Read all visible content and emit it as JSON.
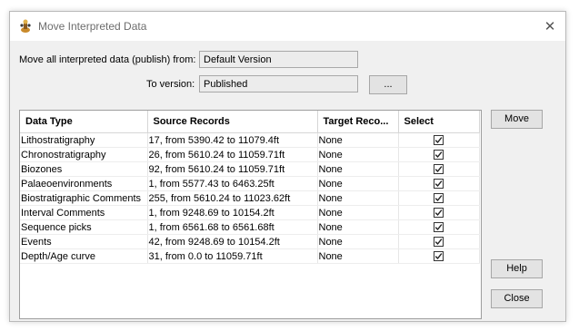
{
  "window": {
    "title": "Move Interpreted Data",
    "icon": "app-icon",
    "close_icon": "close-icon"
  },
  "form": {
    "from_label": "Move all interpreted data (publish) from:",
    "from_value": "Default Version",
    "to_label": "To version:",
    "to_value": "Published",
    "browse_label": "..."
  },
  "table": {
    "headers": [
      "Data Type",
      "Source Records",
      "Target Reco...",
      "Select"
    ],
    "rows": [
      {
        "type": "Lithostratigraphy",
        "source": "17, from 5390.42 to 11079.4ft",
        "target": "None",
        "selected": true
      },
      {
        "type": "Chronostratigraphy",
        "source": "26, from 5610.24 to 11059.71ft",
        "target": "None",
        "selected": true
      },
      {
        "type": "Biozones",
        "source": "92, from 5610.24 to 11059.71ft",
        "target": "None",
        "selected": true
      },
      {
        "type": "Palaeoenvironments",
        "source": "1, from 5577.43 to 6463.25ft",
        "target": "None",
        "selected": true
      },
      {
        "type": "Biostratigraphic Comments",
        "source": "255, from 5610.24 to 11023.62ft",
        "target": "None",
        "selected": true
      },
      {
        "type": "Interval Comments",
        "source": "1, from 9248.69 to 10154.2ft",
        "target": "None",
        "selected": true
      },
      {
        "type": "Sequence picks",
        "source": "1, from 6561.68 to 6561.68ft",
        "target": "None",
        "selected": true
      },
      {
        "type": "Events",
        "source": "42, from 9248.69 to 10154.2ft",
        "target": "None",
        "selected": true
      },
      {
        "type": "Depth/Age curve",
        "source": "31, from 0.0 to 11059.71ft",
        "target": "None",
        "selected": true
      }
    ]
  },
  "buttons": {
    "move": "Move",
    "help": "Help",
    "close": "Close"
  }
}
